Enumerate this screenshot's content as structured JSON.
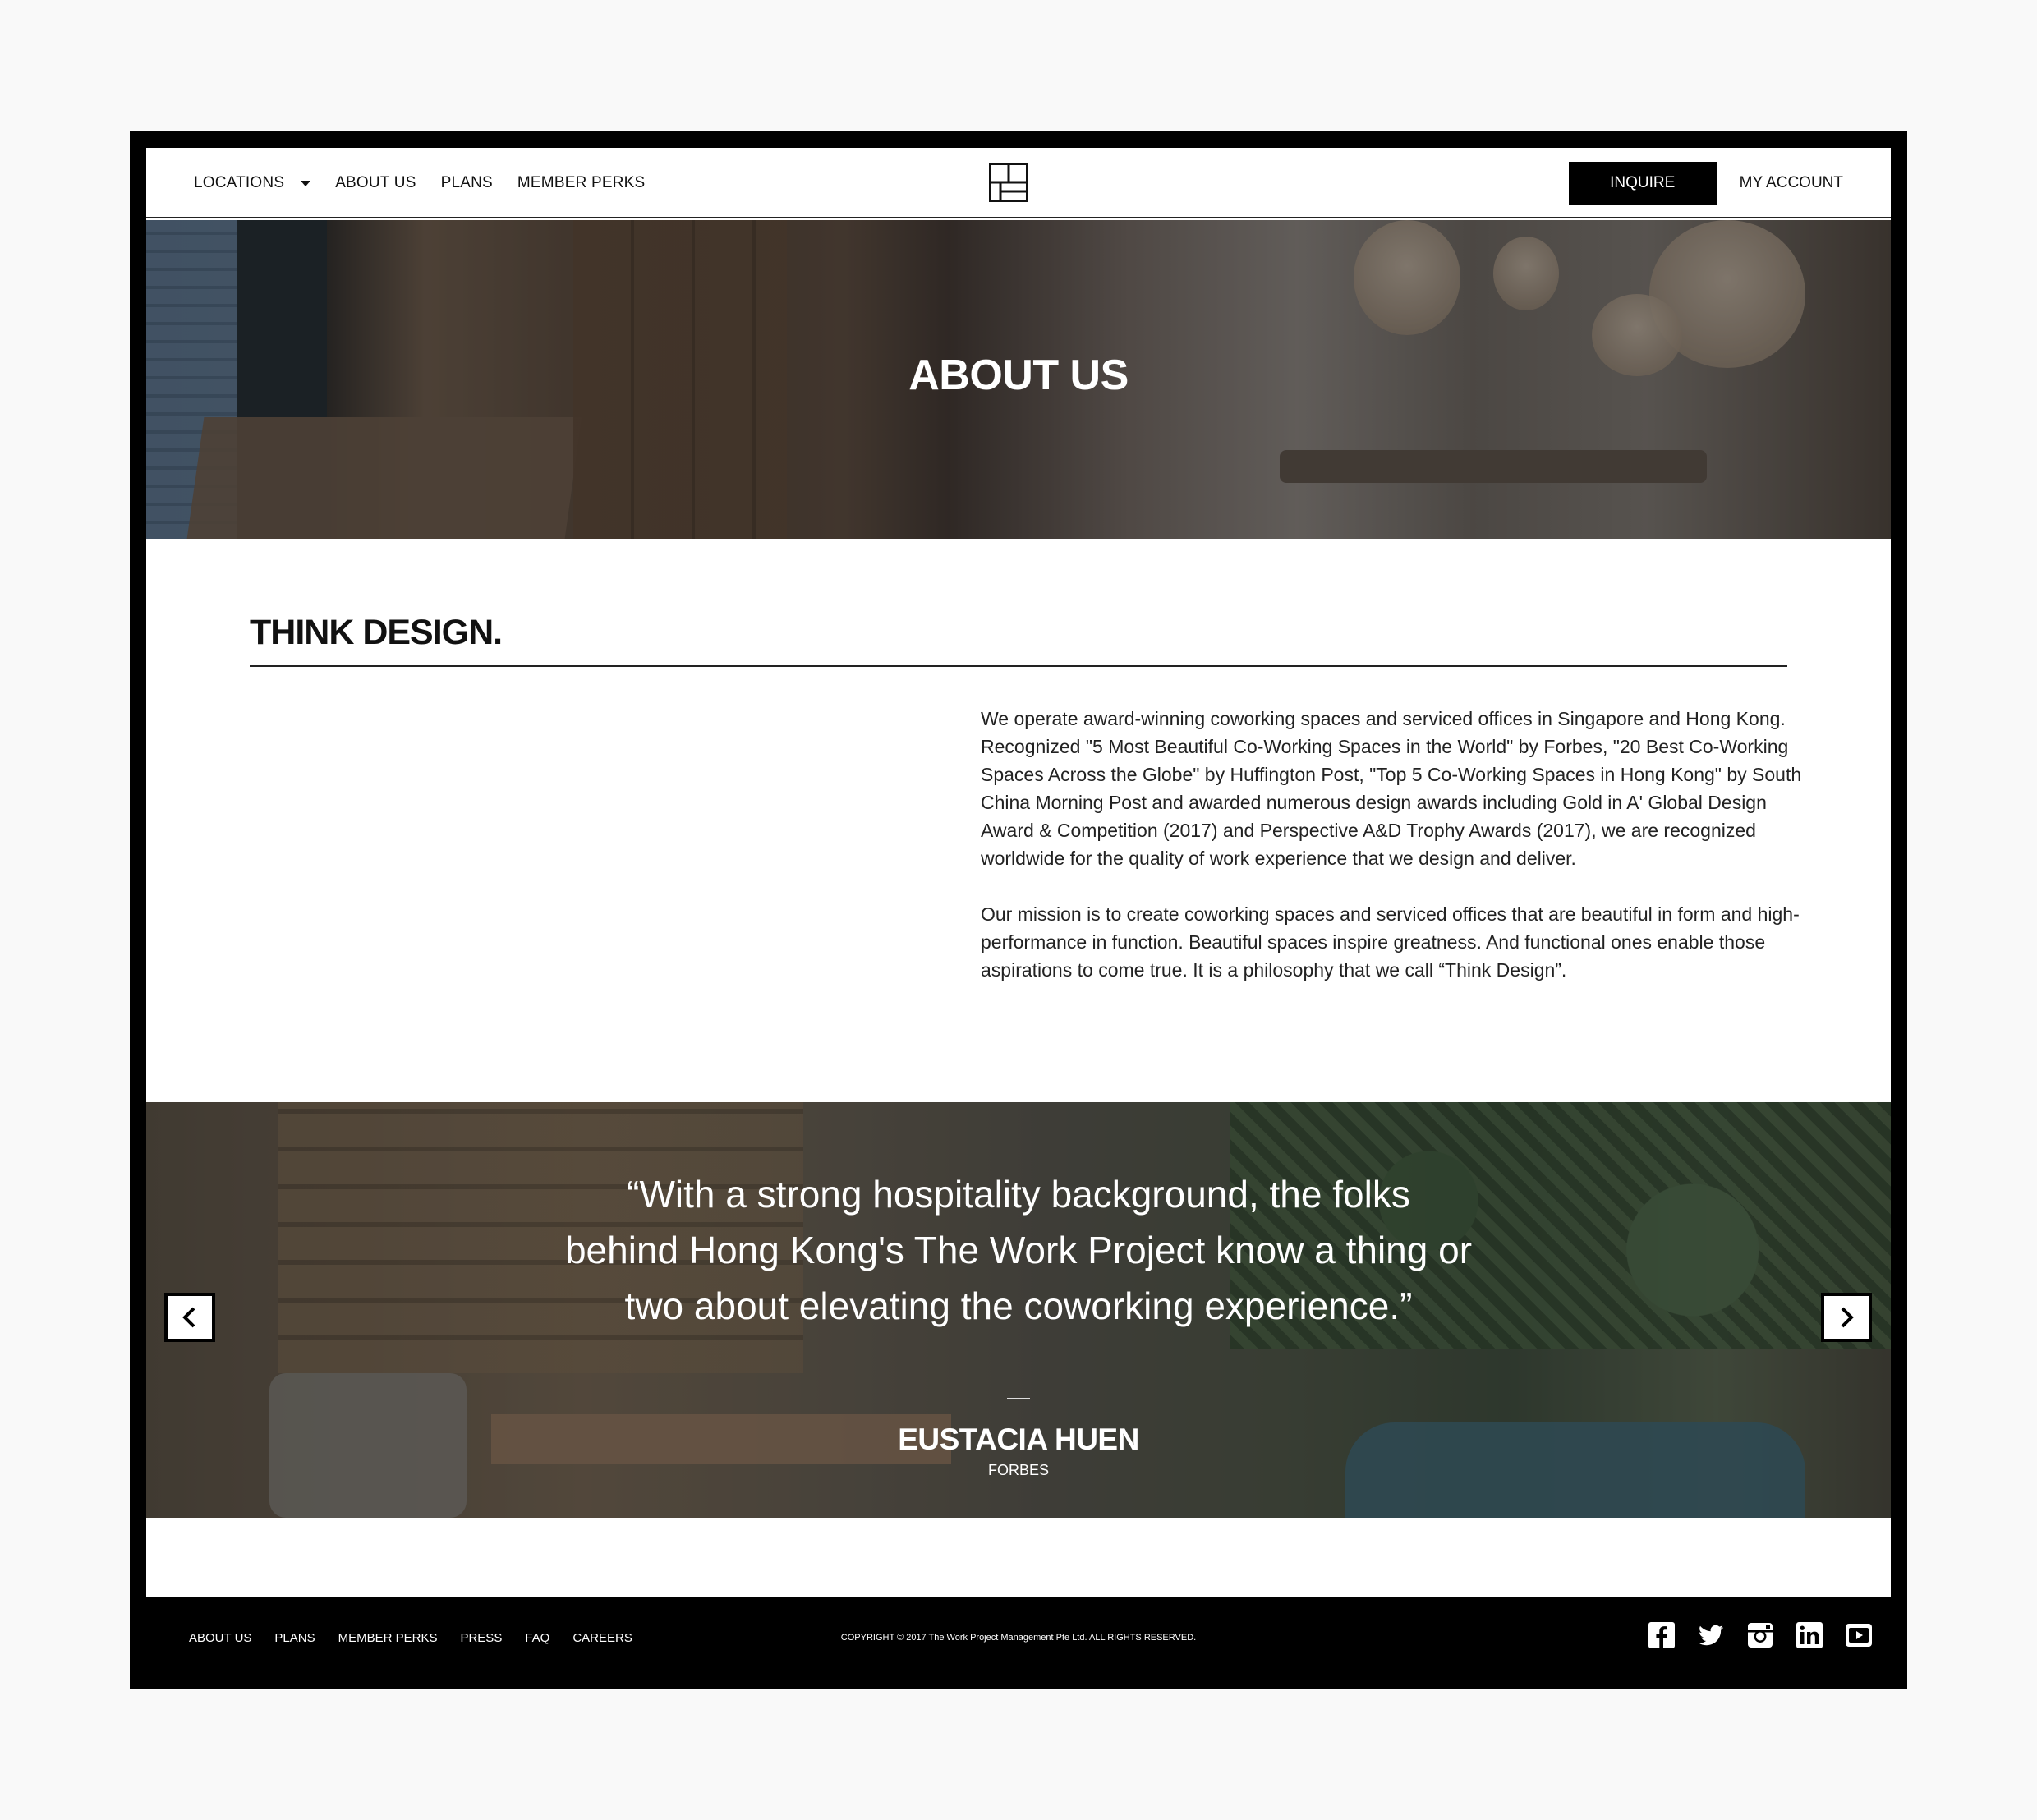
{
  "nav": {
    "locations": "LOCATIONS",
    "about": "ABOUT US",
    "plans": "PLANS",
    "perks": "MEMBER PERKS",
    "inquire": "INQUIRE",
    "account": "MY ACCOUNT"
  },
  "hero": {
    "title": "ABOUT US"
  },
  "content": {
    "heading": "THINK DESIGN.",
    "paragraph1": "We operate award-winning coworking spaces and serviced offices in Singapore and Hong Kong. Recognized \"5 Most Beautiful Co-Working Spaces in the World\" by Forbes, \"20 Best Co-Working Spaces Across the Globe\" by Huffington Post, \"Top 5 Co-Working Spaces in Hong Kong\" by South China Morning Post and awarded numerous design awards including Gold in A' Global Design Award & Competition (2017) and Perspective A&D Trophy Awards (2017), we are recognized worldwide for the quality of work experience that we design and deliver.",
    "paragraph2": "Our mission is to create coworking spaces and serviced offices that are beautiful in form and high-performance in function. Beautiful spaces inspire greatness. And functional ones enable those aspirations to come true. It is a philosophy that we call “Think Design”."
  },
  "testimonial": {
    "quote_lines": [
      "“With a strong hospitality background, the folks",
      "behind Hong Kong's The Work Project know a thing or",
      "two about elevating the coworking experience.”"
    ],
    "author": "EUSTACIA HUEN",
    "source": "FORBES"
  },
  "footer": {
    "links": [
      "ABOUT US",
      "PLANS",
      "MEMBER PERKS",
      "PRESS",
      "FAQ",
      "CAREERS"
    ],
    "copyright": "COPYRIGHT © 2017 The Work Project Management Pte Ltd. ALL RIGHTS RESERVED.",
    "socials": [
      "facebook-icon",
      "twitter-icon",
      "instagram-icon",
      "linkedin-icon",
      "youtube-icon"
    ]
  }
}
